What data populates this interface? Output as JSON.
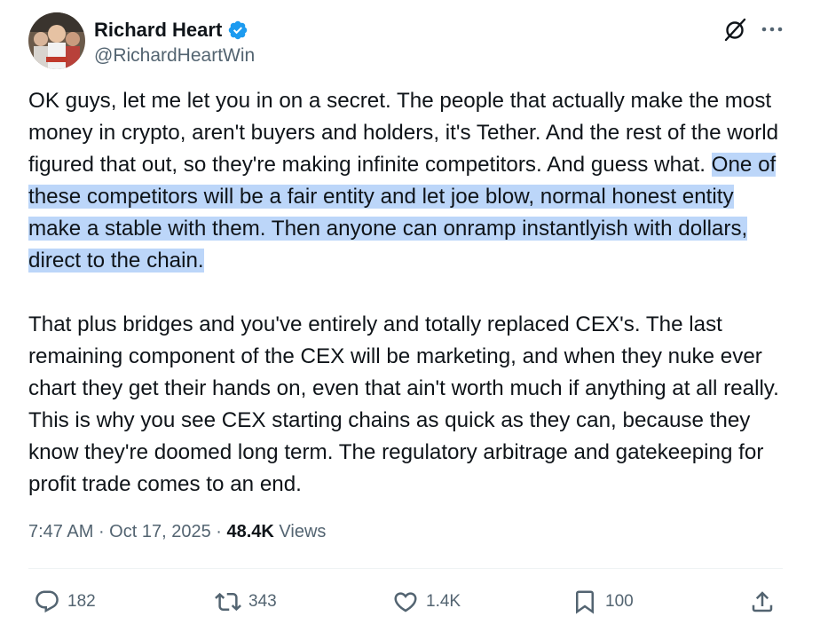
{
  "author": {
    "display_name": "Richard Heart",
    "handle": "@RichardHeartWin",
    "verified": true,
    "verified_color": "#1d9bf0"
  },
  "header_icons": [
    "grok-icon",
    "more-options-icon"
  ],
  "post": {
    "p1_plain": "OK guys, let me let you in on a secret. The people that actually make the most money in crypto, aren't buyers and holders, it's Tether. And the rest of the world figured that out, so they're making infinite competitors. And guess what. ",
    "p1_highlighted": "One of these competitors will be a fair entity and let joe blow, normal honest entity make a stable with them. Then anyone can onramp instantlyish with dollars, direct to the chain.",
    "p2": "That plus bridges and you've entirely and totally replaced CEX's. The last remaining component of the CEX will be marketing, and when they nuke ever chart they get their hands on, even that ain't worth much if anything at all really.  This is why you see CEX starting chains as quick as they can, because they know they're doomed long term. The regulatory arbitrage and gatekeeping for profit trade comes to an end.",
    "highlight_color": "#bcd6f9"
  },
  "meta": {
    "time": "7:47 AM",
    "separator": " · ",
    "date": "Oct 17, 2025",
    "views_count": "48.4K",
    "views_label": " Views"
  },
  "actions": {
    "replies": "182",
    "reposts": "343",
    "likes": "1.4K",
    "bookmarks": "100"
  },
  "colors": {
    "text": "#0f1419",
    "secondary": "#536471",
    "divider": "#eff3f4"
  }
}
